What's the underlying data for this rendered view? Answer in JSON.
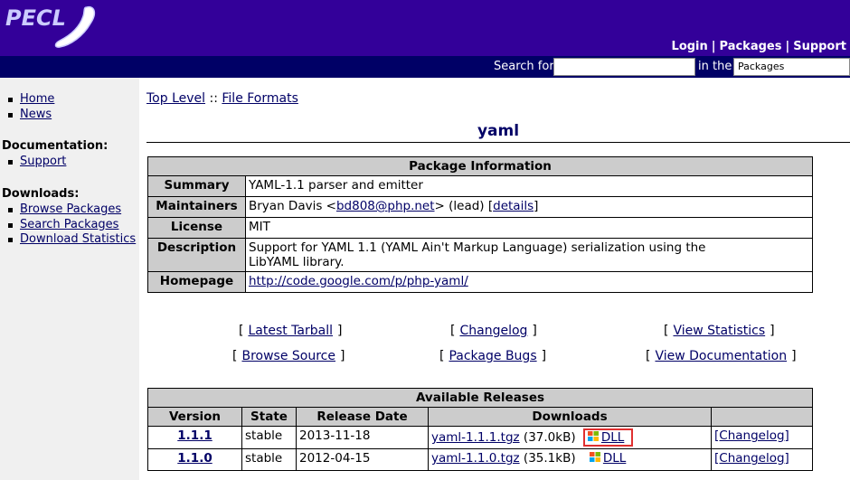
{
  "header": {
    "logo_text": "PECL",
    "links": [
      "Login",
      "Packages",
      "Support"
    ]
  },
  "search": {
    "label": "Search for",
    "input_value": "",
    "in_the": "in the",
    "scope_selected": "Packages"
  },
  "sidebar": {
    "nav": [
      "Home",
      "News"
    ],
    "documentation_title": "Documentation:",
    "documentation": [
      "Support"
    ],
    "downloads_title": "Downloads:",
    "downloads": [
      "Browse Packages",
      "Search Packages",
      "Download Statistics"
    ]
  },
  "breadcrumb": {
    "top": "Top Level",
    "sep": "::",
    "category": "File Formats"
  },
  "package": {
    "name": "yaml",
    "info_title": "Package Information",
    "summary_label": "Summary",
    "summary": "YAML-1.1 parser and emitter",
    "maintainers_label": "Maintainers",
    "maintainer_name": "Bryan Davis <",
    "maintainer_email": "bd808@php.net",
    "maintainer_role": "> (lead) [",
    "maintainer_details": "details",
    "maintainer_close": "]",
    "license_label": "License",
    "license": "MIT",
    "description_label": "Description",
    "description_line1": "Support for YAML 1.1 (YAML Ain't Markup Language) serialization using the",
    "description_line2": "LibYAML library.",
    "homepage_label": "Homepage",
    "homepage": "http://code.google.com/p/php-yaml/"
  },
  "links": {
    "latest_tarball": "Latest Tarball",
    "changelog": "Changelog",
    "view_statistics": "View Statistics",
    "browse_source": "Browse Source",
    "package_bugs": "Package Bugs",
    "view_documentation": "View Documentation",
    "open_bracket": "[",
    "close_bracket": "]"
  },
  "releases": {
    "title": "Available Releases",
    "columns": [
      "Version",
      "State",
      "Release Date",
      "Downloads",
      ""
    ],
    "rows": [
      {
        "version": "1.1.1",
        "state": "stable",
        "date": "2013-11-18",
        "file": "yaml-1.1.1.tgz",
        "size": "(37.0kB)",
        "dll": "DLL",
        "changelog": "[Changelog]"
      },
      {
        "version": "1.1.0",
        "state": "stable",
        "date": "2012-04-15",
        "file": "yaml-1.1.0.tgz",
        "size": "(35.1kB)",
        "dll": "DLL",
        "changelog": "[Changelog]"
      }
    ]
  },
  "colors": {
    "header_bg": "#330099",
    "searchbar_bg": "#000066",
    "table_header_bg": "#cccccc",
    "highlight": "#e03030"
  }
}
